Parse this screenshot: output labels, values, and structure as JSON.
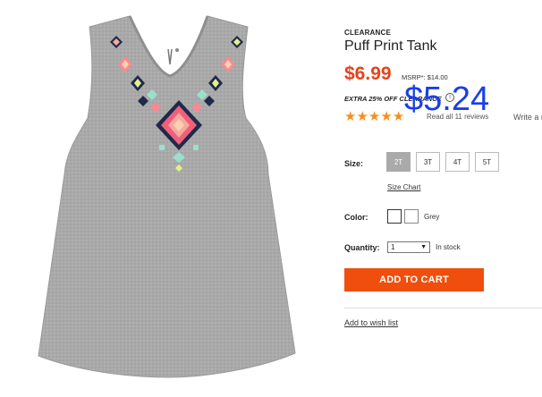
{
  "product": {
    "badge": "CLEARANCE",
    "title": "Puff Print Tank",
    "price": "$6.99",
    "msrp": "MSRP*: $14.00",
    "promo": "EXTRA 25% OFF CLEARANCE",
    "promo_icon": "i",
    "discounted_price": "$5.24",
    "rating_stars": 5,
    "review_text": "Read all 11 reviews",
    "write_review": "Write a review"
  },
  "size": {
    "label": "Size:",
    "options": [
      "2T",
      "3T",
      "4T",
      "5T"
    ],
    "selected": "2T",
    "chart_link": "Size Chart"
  },
  "color": {
    "label": "Color:",
    "name": "Grey"
  },
  "quantity": {
    "label": "Quantity:",
    "value": "1",
    "stock": "In stock"
  },
  "actions": {
    "add_to_cart": "ADD TO CART",
    "wishlist": "Add to wish list"
  },
  "colors": {
    "price": "#e4431b",
    "add_to_cart_bg": "#f04e0c",
    "overlay_price": "#1a3fe6",
    "stars": "#f5901e"
  }
}
